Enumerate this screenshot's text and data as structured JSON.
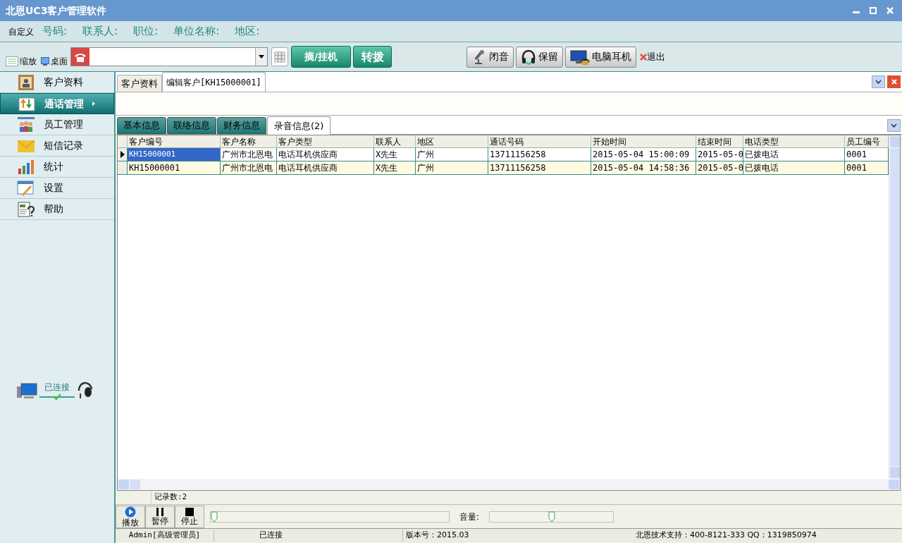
{
  "window": {
    "title": "北恩UC3客户管理软件"
  },
  "info_bar": {
    "custom_label": "自定义",
    "fields": [
      "号码:",
      "联系人:",
      "职位:",
      "单位名称:",
      "地区:"
    ]
  },
  "toolbar": {
    "zoom_label": "缩放",
    "desktop_label": "桌面",
    "dial_button": "摘/挂机",
    "transfer_button": "转拨",
    "buttons": [
      {
        "kind": "mic",
        "label": "闭音"
      },
      {
        "kind": "headphones",
        "label": "保留"
      },
      {
        "kind": "pc",
        "label": "电脑耳机"
      }
    ],
    "exit_label": "退出"
  },
  "sidebar": {
    "items": [
      {
        "kind": "contacts",
        "label": "客户资料",
        "selected": false
      },
      {
        "kind": "calls",
        "label": "通话管理",
        "selected": true
      },
      {
        "kind": "staff",
        "label": "员工管理",
        "selected": false
      },
      {
        "kind": "sms",
        "label": "短信记录",
        "selected": false
      },
      {
        "kind": "stats",
        "label": "统计",
        "selected": false
      },
      {
        "kind": "settings",
        "label": "设置",
        "selected": false
      },
      {
        "kind": "help",
        "label": "帮助",
        "selected": false
      }
    ],
    "connection": "已连接"
  },
  "doc_tabs": [
    {
      "label": "客户资料",
      "selected": false
    },
    {
      "label": "编辑客户[KH15000001]",
      "selected": true
    }
  ],
  "sub_tabs": [
    {
      "label": "基本信息",
      "selected": false
    },
    {
      "label": "联络信息",
      "selected": false
    },
    {
      "label": "财务信息",
      "selected": false
    },
    {
      "label": "录音信息(2)",
      "selected": true
    }
  ],
  "table": {
    "columns": [
      "客户编号",
      "客户名称",
      "客户类型",
      "联系人",
      "地区",
      "通话号码",
      "开始时间",
      "结束时间",
      "电话类型",
      "员工编号"
    ],
    "rows": [
      {
        "selected": true,
        "cells": [
          "KH15000001",
          "广州市北恩电",
          "电话耳机供应商",
          "X先生",
          "广州",
          "13711156258",
          "2015-05-04 15:00:09",
          "2015-05-0",
          "已拨电话",
          "0001"
        ]
      },
      {
        "selected": false,
        "cells": [
          "KH15000001",
          "广州市北恩电",
          "电话耳机供应商",
          "X先生",
          "广州",
          "13711156258",
          "2015-05-04 14:58:36",
          "2015-05-0",
          "已拨电话",
          "0001"
        ]
      }
    ]
  },
  "record_count": "记录数:2",
  "player": {
    "buttons": [
      {
        "kind": "play",
        "label": "播放"
      },
      {
        "kind": "pause",
        "label": "暂停"
      },
      {
        "kind": "stop",
        "label": "停止"
      }
    ],
    "progress": {
      "level": 0
    },
    "volume_label": "音量:",
    "volume": {
      "level": 0.5
    }
  },
  "status_bar": [
    "Admin[高级管理员]",
    "已连接",
    "版本号：2015.03",
    "北恩技术支持：400-8121-333 QQ：1319850974"
  ]
}
